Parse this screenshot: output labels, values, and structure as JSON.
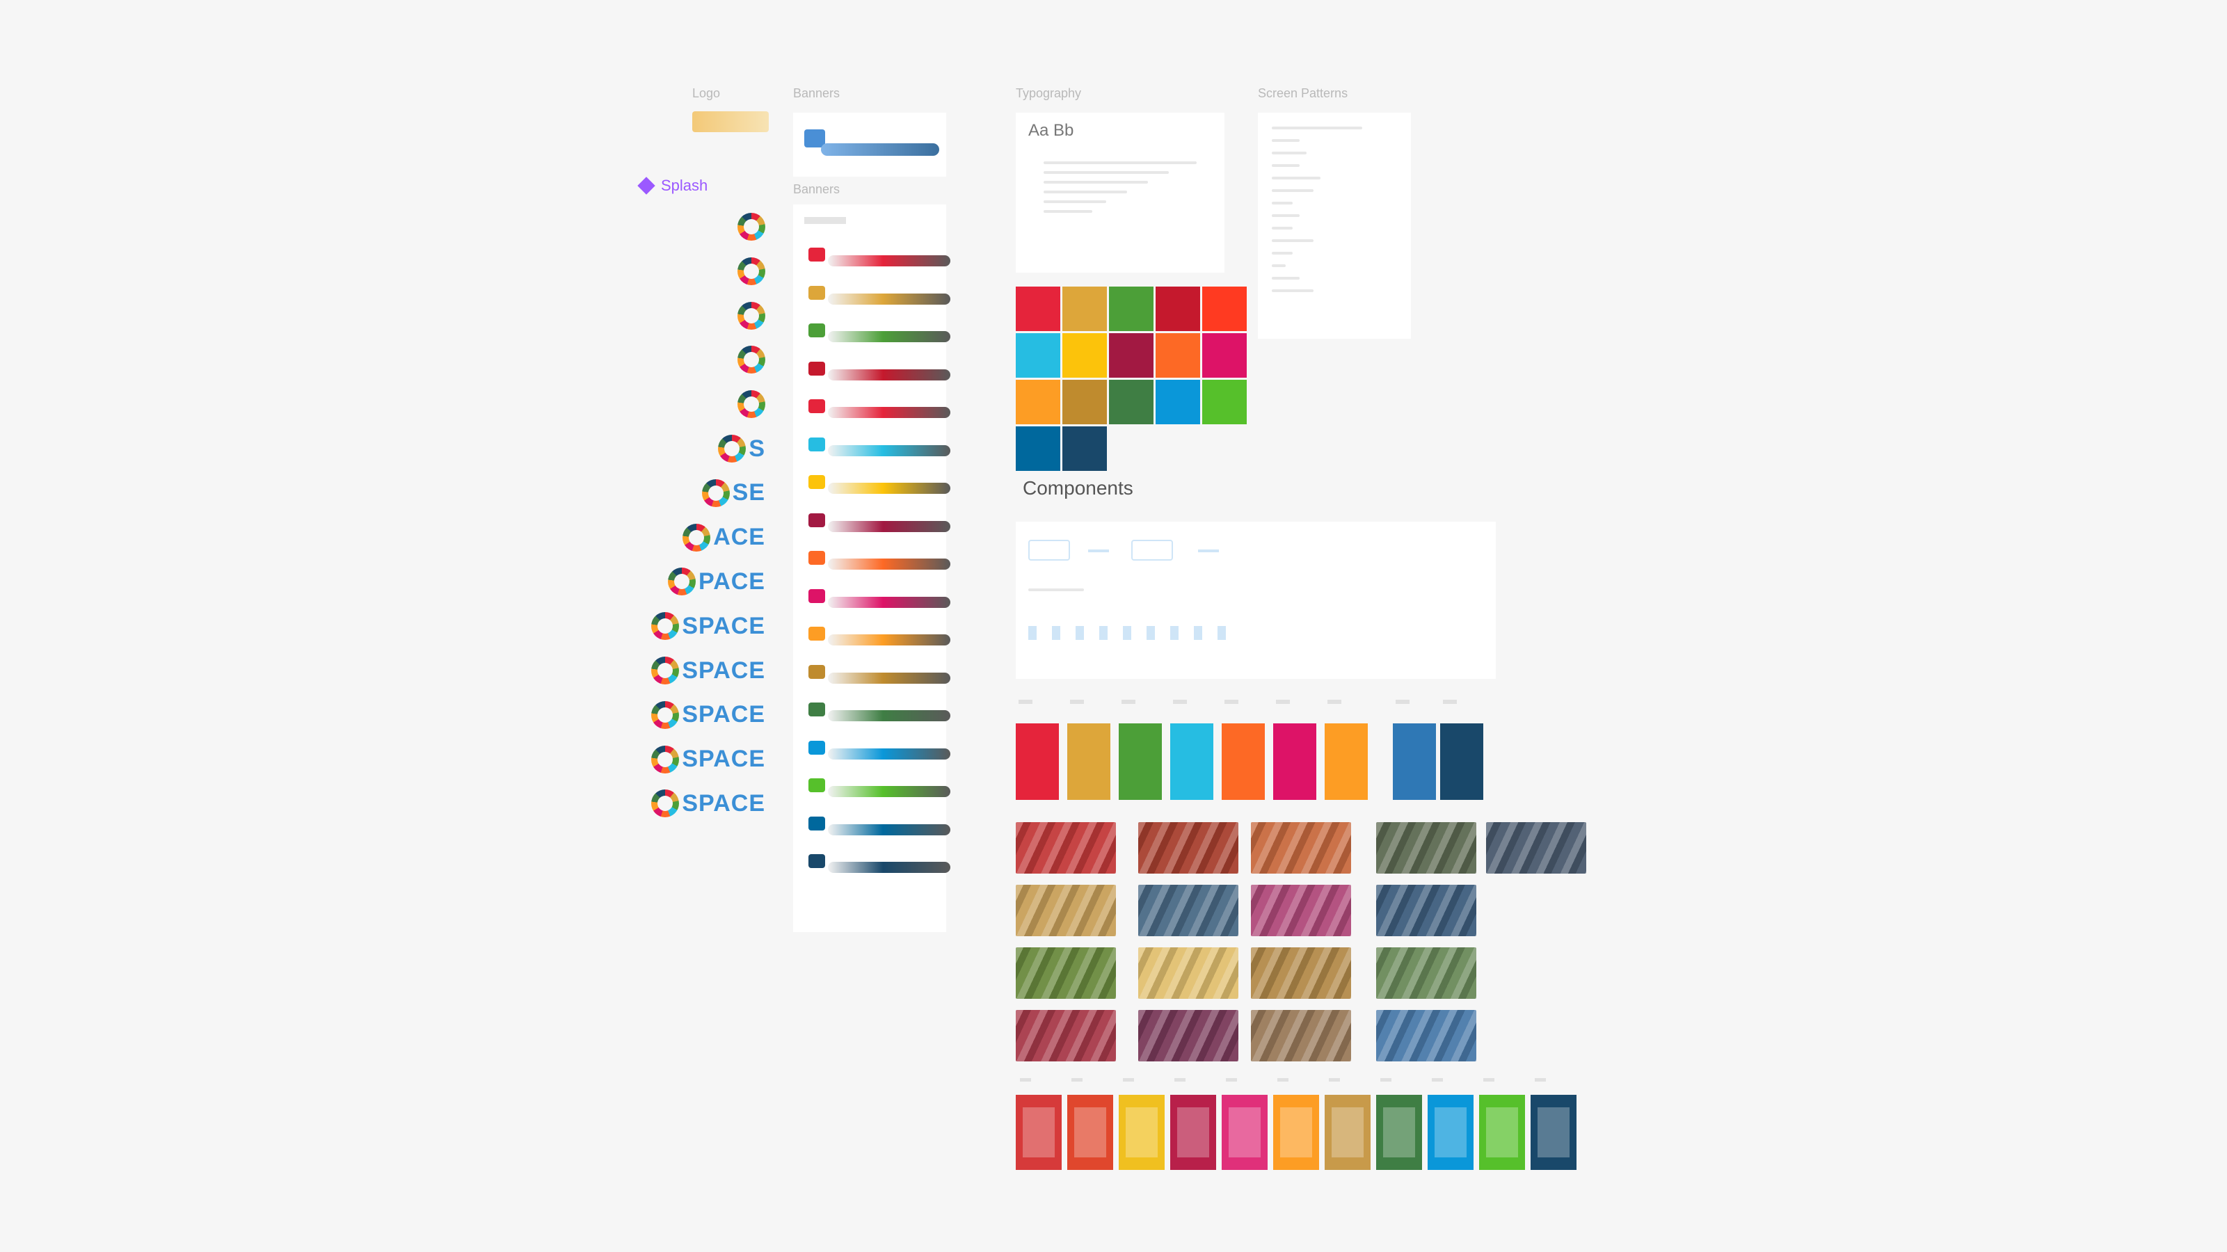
{
  "sections": {
    "logo": "Logo",
    "banners": "Banners",
    "banners_sub": "Banners",
    "typography": "Typography",
    "screen_patterns": "Screen Patterns",
    "components": "Components"
  },
  "splash": {
    "label": "Splash",
    "words": [
      "",
      "",
      "",
      "",
      "",
      "S",
      "SE",
      "ACE",
      "PACE",
      "SPACE",
      "SPACE",
      "SPACE",
      "SPACE",
      "SPACE"
    ]
  },
  "typography": {
    "sample": "Aa Bb"
  },
  "colors": {
    "sdg": [
      "#e5243b",
      "#dda63a",
      "#4c9f38",
      "#c5192d",
      "#ff3a21",
      "#26bde2",
      "#fcc30b",
      "#a21942",
      "#fd6925",
      "#dd1367",
      "#fd9d24",
      "#bf8b2e",
      "#3f7e44",
      "#0a97d9",
      "#56c02b",
      "#00689d",
      "#19486a"
    ],
    "swatches": [
      "#e5243b",
      "#dda63a",
      "#4c9f38",
      "#26bde2",
      "#fd6925",
      "#dd1367",
      "#fd9d24",
      "#2f78b5",
      "#19486a"
    ],
    "banners": [
      "#e5243b",
      "#dda63a",
      "#4c9f38",
      "#c5192d",
      "#e5243b",
      "#26bde2",
      "#fcc30b",
      "#a21942",
      "#fd6925",
      "#dd1367",
      "#fd9d24",
      "#bf8b2e",
      "#3f7e44",
      "#0a97d9",
      "#56c02b",
      "#00689d",
      "#19486a"
    ],
    "photos": [
      "#c33a3a",
      "#a8402f",
      "#c86a3f",
      "#5d6a52",
      "#4a5a6e",
      "#c8a05a",
      "#4a6a86",
      "#b04a7a",
      "#3e5e7e",
      "#6a8a3e",
      "#e2c070",
      "#b38a4a",
      "#6a8a5a",
      "#a83a4a",
      "#7a3a5a",
      "#9a7a5a",
      "#4a7aaa"
    ],
    "posters": [
      "#d63a3a",
      "#e0472d",
      "#f0c020",
      "#b8204a",
      "#e0307a",
      "#fd9d24",
      "#c89a4a",
      "#3f7e44",
      "#0a97d9",
      "#56c02b",
      "#19486a"
    ]
  },
  "icons": {
    "splash_ring": "sdg-color-ring-icon"
  }
}
